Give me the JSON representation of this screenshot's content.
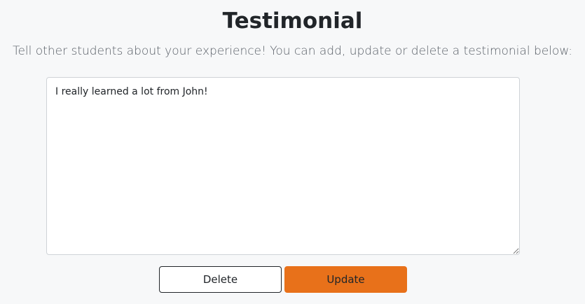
{
  "page": {
    "title": "Testimonial",
    "subtitle": "Tell other students about your experience! You can add, update or delete a testimonial below:"
  },
  "testimonial": {
    "value": "I really learned a lot from John!"
  },
  "actions": {
    "delete_label": "Delete",
    "update_label": "Update"
  },
  "colors": {
    "background": "#f7f8f9",
    "update_button": "#e8711a",
    "delete_button_border": "#212529"
  }
}
